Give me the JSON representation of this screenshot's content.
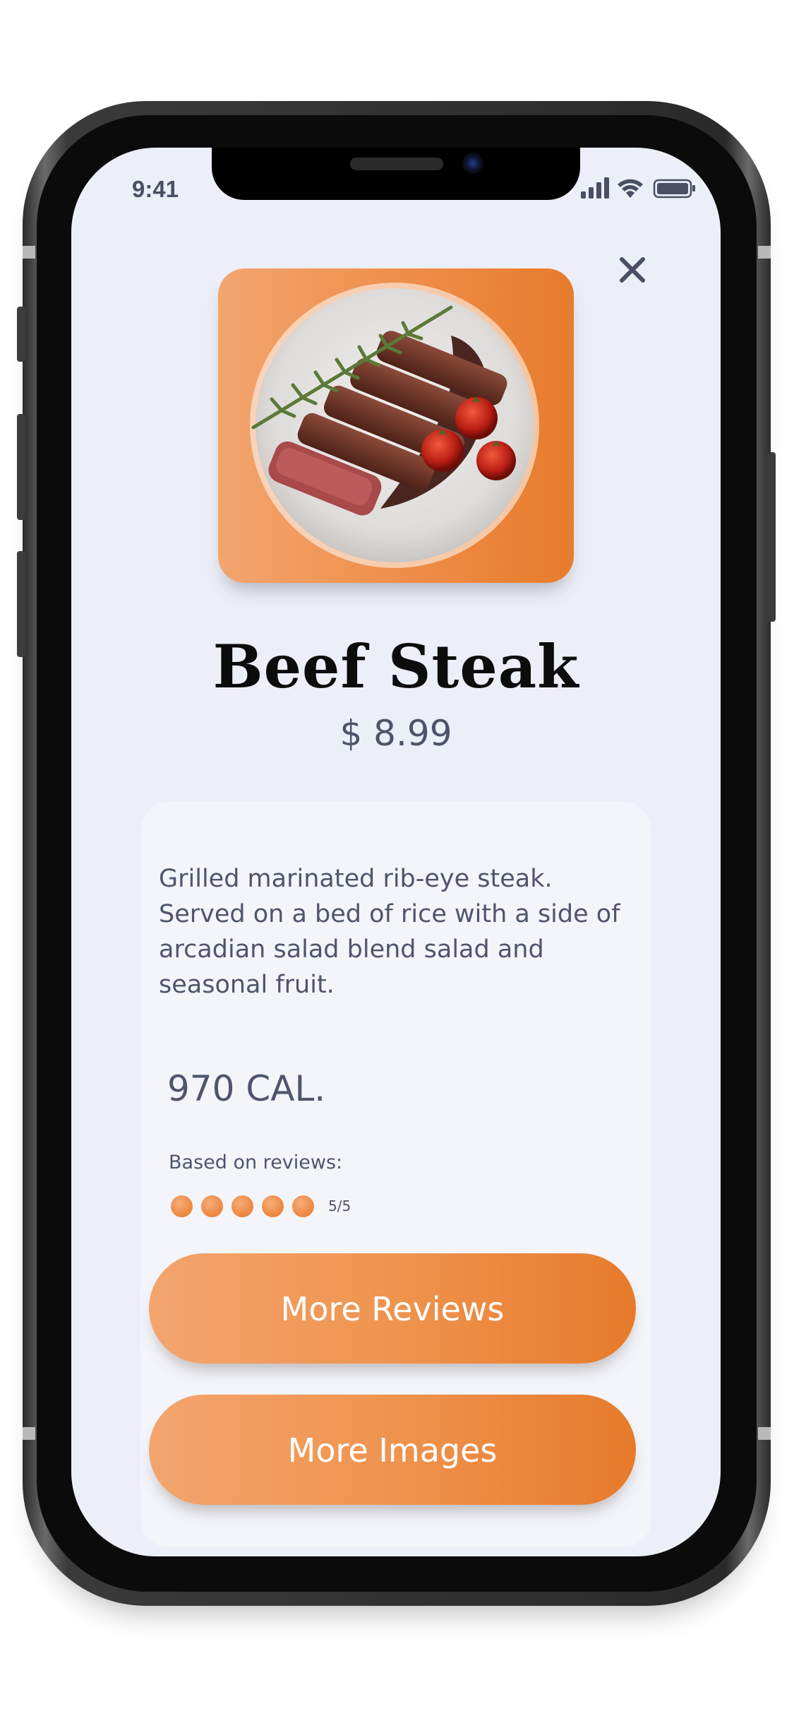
{
  "status_bar": {
    "time": "9:41",
    "icons": [
      "cellular-signal-icon",
      "wifi-icon",
      "battery-icon"
    ]
  },
  "header": {
    "close_icon": "close-icon",
    "close_glyph": "X"
  },
  "product": {
    "image_alt": "steak-plate-image",
    "name": "Beef Steak",
    "price": "$ 8.99",
    "description": "Grilled marinated rib-eye steak. Served on a bed of rice with a side of arcadian salad blend salad and seasonal fruit.",
    "calories": "970 CAL.",
    "reviews_label": "Based on reviews:",
    "rating": {
      "value": 5,
      "max": 5,
      "text": "5/5"
    }
  },
  "actions": {
    "more_reviews": "More Reviews",
    "more_images": "More Images"
  },
  "colors": {
    "accent_start": "#f3a56e",
    "accent_end": "#e77a2a",
    "background": "#eceff8",
    "card": "#f3f5fb",
    "text": "#4f556b"
  }
}
